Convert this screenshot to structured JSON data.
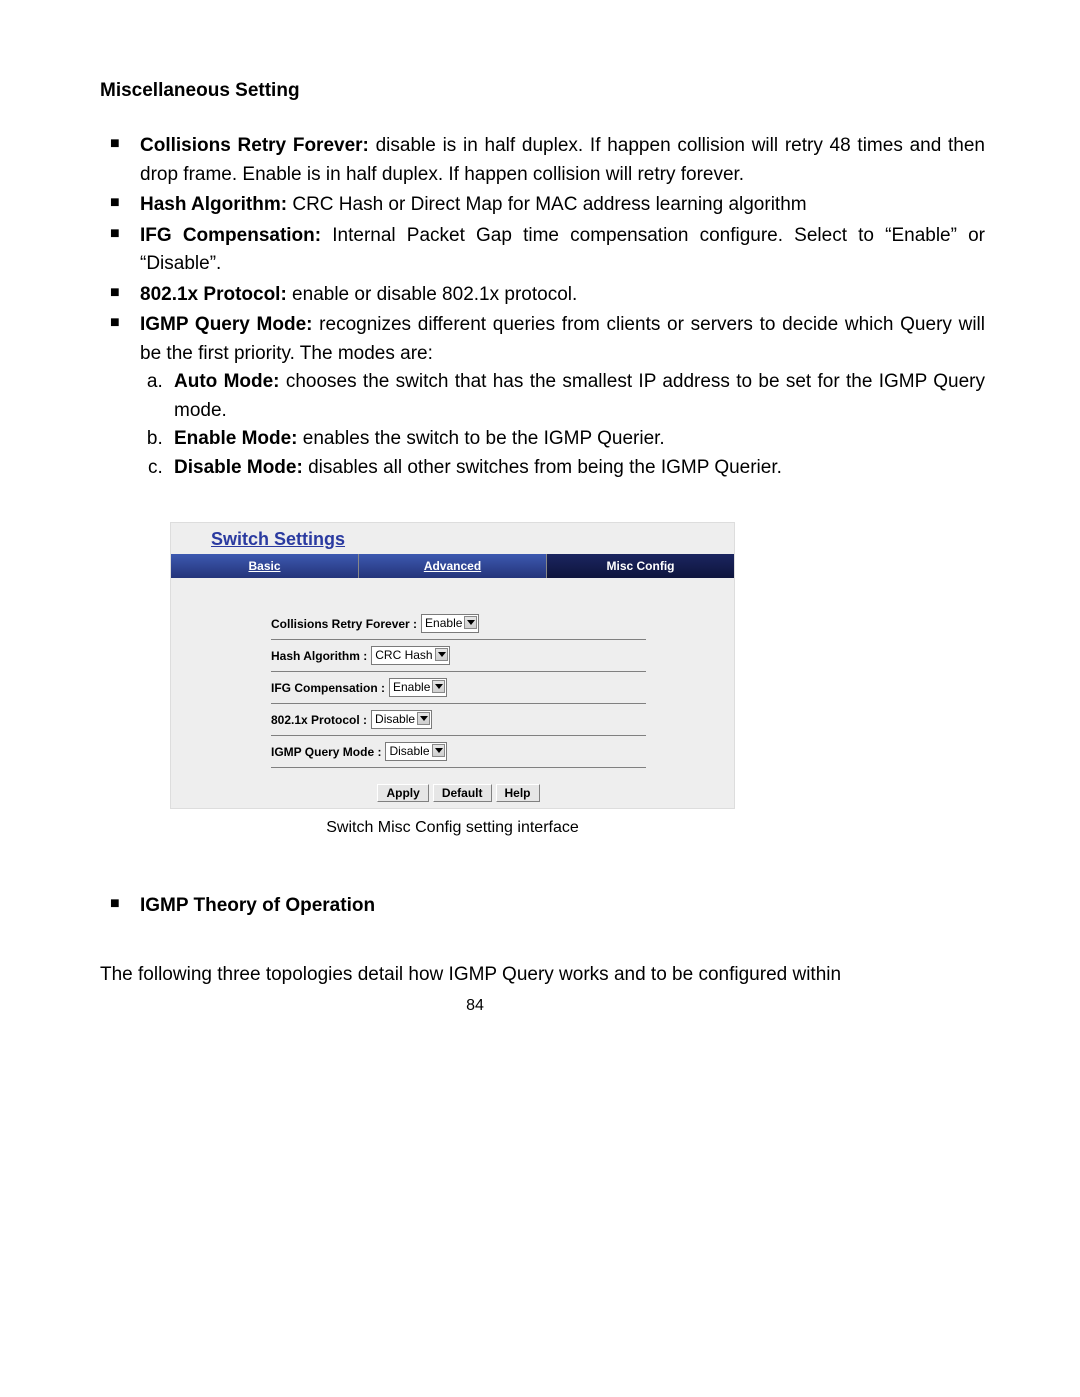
{
  "heading": "Miscellaneous Setting",
  "bullets": [
    {
      "label": "Collisions Retry Forever:",
      "text": " disable is in half duplex. If happen collision will retry 48 times and then drop frame. Enable is in half duplex. If happen collision will retry forever."
    },
    {
      "label": "Hash Algorithm:",
      "text": " CRC Hash or Direct Map for MAC address learning algorithm"
    },
    {
      "label": "IFG Compensation:",
      "text": " Internal Packet Gap time compensation configure. Select to “Enable” or “Disable”."
    },
    {
      "label": "802.1x Protocol:",
      "text": " enable or disable 802.1x protocol."
    },
    {
      "label": "IGMP Query Mode:",
      "text": " recognizes different queries from clients or servers to decide which Query will be the first priority. The modes are:"
    }
  ],
  "sublist": [
    {
      "label": "Auto Mode:",
      "text": " chooses the switch that has the smallest IP address to be set for the IGMP Query mode."
    },
    {
      "label": "Enable Mode:",
      "text": " enables the switch to be the IGMP Querier."
    },
    {
      "label": "Disable Mode:",
      "text": " disables all other switches from being the IGMP Querier."
    }
  ],
  "panel": {
    "title": "Switch Settings",
    "tabs": {
      "basic": "Basic",
      "advanced": "Advanced",
      "misc": "Misc Config"
    },
    "rows": {
      "collisions": {
        "label": "Collisions Retry Forever :",
        "value": "Enable"
      },
      "hash": {
        "label": "Hash Algorithm :",
        "value": "CRC Hash"
      },
      "ifg": {
        "label": "IFG Compensation :",
        "value": "Enable"
      },
      "dot1x": {
        "label": "802.1x Protocol :",
        "value": "Disable"
      },
      "igmp": {
        "label": "IGMP Query Mode :",
        "value": "Disable"
      }
    },
    "buttons": {
      "apply": "Apply",
      "default": "Default",
      "help": "Help"
    }
  },
  "caption": "Switch Misc Config setting interface",
  "section2_bullet": "IGMP Theory of Operation",
  "para": "The following three topologies detail how IGMP Query works and to be configured within",
  "page_number": "84"
}
